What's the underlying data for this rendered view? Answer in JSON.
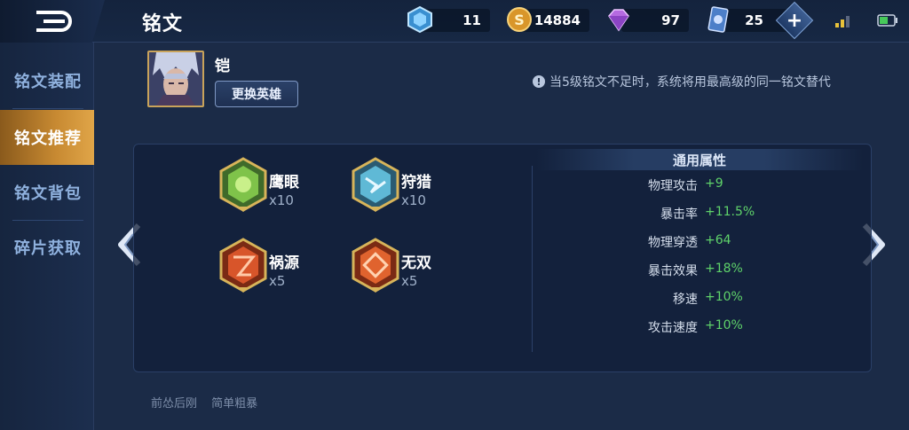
{
  "header": {
    "title": "铭文",
    "currencies": [
      {
        "name": "diamond-coupon",
        "value": "11",
        "color": "#4fb6e8"
      },
      {
        "name": "gold-coin",
        "value": "14884",
        "color": "#e0a93a"
      },
      {
        "name": "diamond",
        "value": "97",
        "color": "#c07be8"
      },
      {
        "name": "coupon",
        "value": "25",
        "color": "#6e9ee0"
      }
    ],
    "add_label": "+"
  },
  "sidebar": {
    "items": [
      {
        "label": "铭文装配",
        "active": false
      },
      {
        "label": "铭文推荐",
        "active": true
      },
      {
        "label": "铭文背包",
        "active": false
      },
      {
        "label": "碎片获取",
        "active": false
      }
    ]
  },
  "hero": {
    "name": "铠",
    "change_button": "更换英雄"
  },
  "notice": {
    "icon": "!",
    "text": "当5级铭文不足时，系统将用最高级的同一铭文替代"
  },
  "runes": [
    {
      "name": "鹰眼",
      "count": "x10",
      "color": "green",
      "icon": "eagle-eye-rune-icon"
    },
    {
      "name": "狩猎",
      "count": "x10",
      "color": "blue",
      "icon": "hunt-rune-icon"
    },
    {
      "name": "祸源",
      "count": "x5",
      "color": "red",
      "icon": "calamity-rune-icon"
    },
    {
      "name": "无双",
      "count": "x5",
      "color": "red",
      "icon": "peerless-rune-icon"
    }
  ],
  "attributes": {
    "title": "通用属性",
    "rows": [
      {
        "label": "物理攻击",
        "value": "+9"
      },
      {
        "label": "暴击率",
        "value": "+11.5%"
      },
      {
        "label": "物理穿透",
        "value": "+64"
      },
      {
        "label": "暴击效果",
        "value": "+18%"
      },
      {
        "label": "移速",
        "value": "+10%"
      },
      {
        "label": "攻击速度",
        "value": "+10%"
      }
    ]
  },
  "tags": [
    "前怂后刚",
    "简单粗暴"
  ],
  "colors": {
    "accent_active": "#c88a32",
    "positive": "#5fd36a",
    "background": "#1b2b47"
  }
}
